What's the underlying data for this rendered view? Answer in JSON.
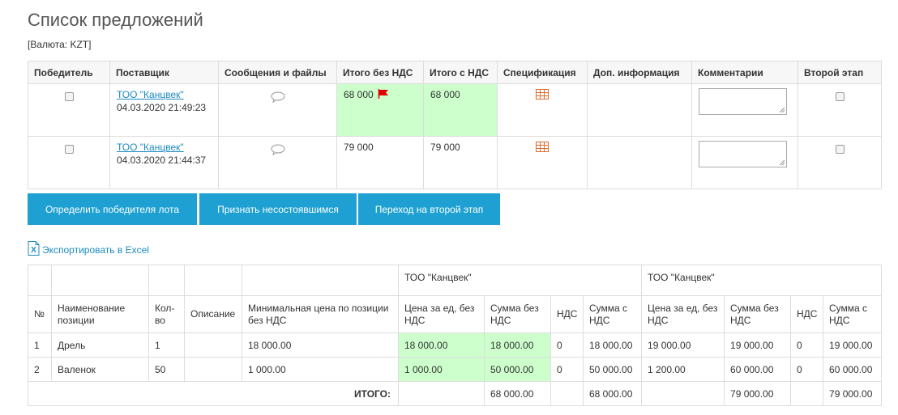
{
  "page": {
    "title": "Список предложений",
    "currency": "[Валюта: KZT]"
  },
  "offers": {
    "headers": [
      "Победитель",
      "Поставщик",
      "Сообщения и файлы",
      "Итого без НДС",
      "Итого с НДС",
      "Спецификация",
      "Доп. информация",
      "Комментарии",
      "Второй этап"
    ],
    "rows": [
      {
        "supplier": "ТОО \"Канцвек\"",
        "date": "04.03.2020 21:49:23",
        "total_no_vat": "68 000",
        "total_vat": "68 000",
        "highlight": true,
        "flagged": true
      },
      {
        "supplier": "ТОО \"Канцвек\"",
        "date": "04.03.2020 21:44:37",
        "total_no_vat": "79 000",
        "total_vat": "79 000",
        "highlight": false,
        "flagged": false
      }
    ]
  },
  "actions": {
    "determine_winner": "Определить победителя лота",
    "declare_failed": "Признать несостоявшимся",
    "second_stage": "Переход на второй этап"
  },
  "export": {
    "label": "Экспортировать в Excel"
  },
  "items": {
    "suppliers": [
      "ТОО \"Канцвек\"",
      "ТОО \"Канцвек\""
    ],
    "headers": {
      "num": "№",
      "name": "Наименование позиции",
      "qty": "Кол-во",
      "desc": "Описание",
      "min_price": "Минимальная цена по позиции без НДС",
      "unit_price": "Цена за ед, без НДС",
      "sum_no_vat": "Сумма без НДС",
      "vat": "НДС",
      "sum_vat": "Сумма с НДС"
    },
    "rows": [
      {
        "num": "1",
        "name": "Дрель",
        "qty": "1",
        "desc": "",
        "min_price": "18 000.00",
        "s1": {
          "unit": "18 000.00",
          "sum": "18 000.00",
          "vat": "0",
          "sum_vat": "18 000.00"
        },
        "s2": {
          "unit": "19 000.00",
          "sum": "19 000.00",
          "vat": "0",
          "sum_vat": "19 000.00"
        }
      },
      {
        "num": "2",
        "name": "Валенок",
        "qty": "50",
        "desc": "",
        "min_price": "1 000.00",
        "s1": {
          "unit": "1 000.00",
          "sum": "50 000.00",
          "vat": "0",
          "sum_vat": "50 000.00"
        },
        "s2": {
          "unit": "1 200.00",
          "sum": "60 000.00",
          "vat": "0",
          "sum_vat": "60 000.00"
        }
      }
    ],
    "total": {
      "label": "ИТОГО:",
      "s1": {
        "sum": "68 000.00",
        "sum_vat": "68 000.00"
      },
      "s2": {
        "sum": "79 000.00",
        "sum_vat": "79 000.00"
      }
    }
  },
  "colors": {
    "accent": "#1ea1d2",
    "link": "#1b8ac0",
    "highlight": "#ccffcc",
    "flag": "#e00000",
    "spec_icon": "#e06a2b"
  }
}
